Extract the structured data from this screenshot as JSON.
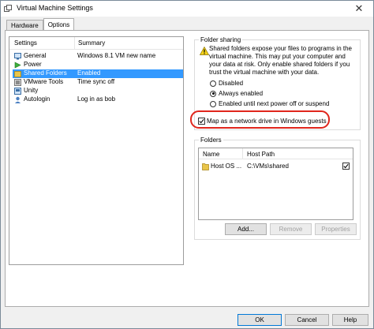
{
  "window": {
    "title": "Virtual Machine Settings",
    "close_glyph": "✕"
  },
  "tabs": [
    {
      "label": "Hardware"
    },
    {
      "label": "Options"
    }
  ],
  "settings_list": {
    "headers": {
      "settings": "Settings",
      "summary": "Summary"
    },
    "items": [
      {
        "label": "General",
        "summary": "Windows 8.1 VM new name",
        "icon": "general-icon",
        "selected": false
      },
      {
        "label": "Power",
        "summary": "",
        "icon": "power-icon",
        "selected": false
      },
      {
        "label": "Shared Folders",
        "summary": "Enabled",
        "icon": "shared-folders-icon",
        "selected": true
      },
      {
        "label": "VMware Tools",
        "summary": "Time sync off",
        "icon": "vmware-tools-icon",
        "selected": false
      },
      {
        "label": "Unity",
        "summary": "",
        "icon": "unity-icon",
        "selected": false
      },
      {
        "label": "Autologin",
        "summary": "Log in as bob",
        "icon": "autologin-icon",
        "selected": false
      }
    ]
  },
  "folder_sharing": {
    "legend": "Folder sharing",
    "warning": "Shared folders expose your files to programs in the virtual machine. This may put your computer and your data at risk. Only enable shared folders if you trust the virtual machine with your data.",
    "options": [
      {
        "label": "Disabled",
        "checked": false
      },
      {
        "label": "Always enabled",
        "checked": true
      },
      {
        "label": "Enabled until next power off or suspend",
        "checked": false
      }
    ],
    "map_drive": {
      "label": "Map as a network drive in Windows guests",
      "checked": true
    }
  },
  "folders": {
    "legend": "Folders",
    "headers": {
      "name": "Name",
      "host_path": "Host Path"
    },
    "rows": [
      {
        "name": "Host OS ...",
        "host_path": "C:\\VMs\\shared",
        "enabled": true
      }
    ],
    "buttons": {
      "add": "Add...",
      "remove": "Remove",
      "properties": "Properties"
    }
  },
  "footer": {
    "ok": "OK",
    "cancel": "Cancel",
    "help": "Help"
  },
  "colors": {
    "selection": "#3399ff",
    "annotation": "#e0261c",
    "accent": "#0078d7"
  }
}
